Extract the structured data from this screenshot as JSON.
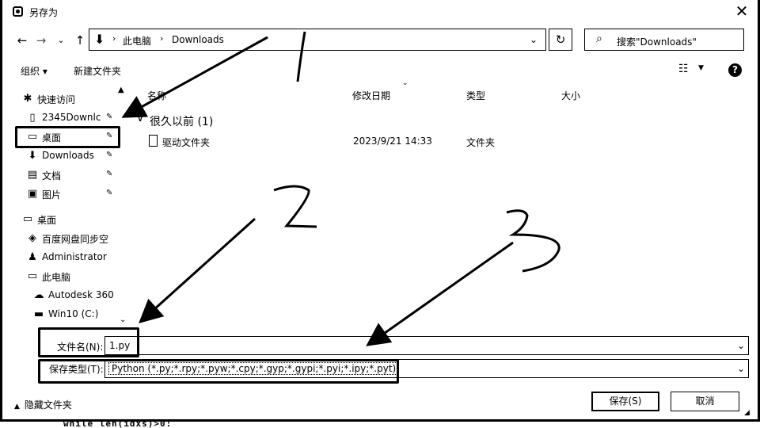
{
  "window": {
    "title": "另存为",
    "close_glyph": "✕"
  },
  "nav": {
    "back": "←",
    "forward": "→",
    "recent": "⌄",
    "up": "↑",
    "refresh": "↻",
    "address": {
      "icon": "download-icon",
      "crumbs": [
        "此电脑",
        "Downloads"
      ],
      "separator": "›",
      "dropdown": "⌄"
    },
    "search_placeholder": "搜索\"Downloads\""
  },
  "toolbar": {
    "organize": "组织 ▾",
    "new_folder": "新建文件夹",
    "view": "☷",
    "view_caret": "▼",
    "help": "?"
  },
  "sidebar": {
    "items": [
      {
        "label": "快速访问",
        "icon": "star-icon",
        "glyph": "✱",
        "pinned": false
      },
      {
        "label": "2345Downlc",
        "icon": "blank-folder-icon",
        "glyph": "▯",
        "pinned": true
      },
      {
        "label": "桌面",
        "icon": "desktop-icon",
        "glyph": "▭",
        "pinned": true
      },
      {
        "label": "Downloads",
        "icon": "download-icon",
        "glyph": "⬇",
        "pinned": true
      },
      {
        "label": "文档",
        "icon": "document-icon",
        "glyph": "▤",
        "pinned": true
      },
      {
        "label": "图片",
        "icon": "picture-icon",
        "glyph": "▣",
        "pinned": true
      },
      {
        "label": "桌面",
        "icon": "desktop-icon",
        "glyph": "▭",
        "pinned": false
      },
      {
        "label": "百度网盘同步空",
        "icon": "cloud-icon",
        "glyph": "◈",
        "pinned": false
      },
      {
        "label": "Administrator",
        "icon": "user-icon",
        "glyph": "♟",
        "pinned": false
      },
      {
        "label": "此电脑",
        "icon": "computer-icon",
        "glyph": "▭",
        "pinned": false
      },
      {
        "label": "Autodesk 360",
        "icon": "cloud-drive-icon",
        "glyph": "☁",
        "pinned": false
      },
      {
        "label": "Win10 (C:)",
        "icon": "drive-icon",
        "glyph": "▬",
        "pinned": false
      }
    ],
    "pin_glyph": "📌"
  },
  "file_list": {
    "columns": [
      "名称",
      "修改日期",
      "类型",
      "大小"
    ],
    "group": {
      "label": "很久以前 (1)",
      "chevron": "∨"
    },
    "rows": [
      {
        "name": "驱动文件夹",
        "modified": "2023/9/21 14:33",
        "type": "文件夹",
        "size": ""
      }
    ]
  },
  "form": {
    "filename_label": "文件名(N):",
    "filename_value": "1.py",
    "filetype_label": "保存类型(T):",
    "filetype_value": "Python (*.py;*.rpy;*.pyw;*.cpy;*.gyp;*.gypi;*.pyi;*.ipy;*.pyt)",
    "dropdown": "⌄"
  },
  "footer": {
    "hide_folders": "隐藏文件夹",
    "save": "保存(S)",
    "cancel": "取消"
  },
  "annotations": {
    "marks": [
      "1",
      "2",
      "3"
    ]
  },
  "background_strip": "while len(idxs)>0:"
}
